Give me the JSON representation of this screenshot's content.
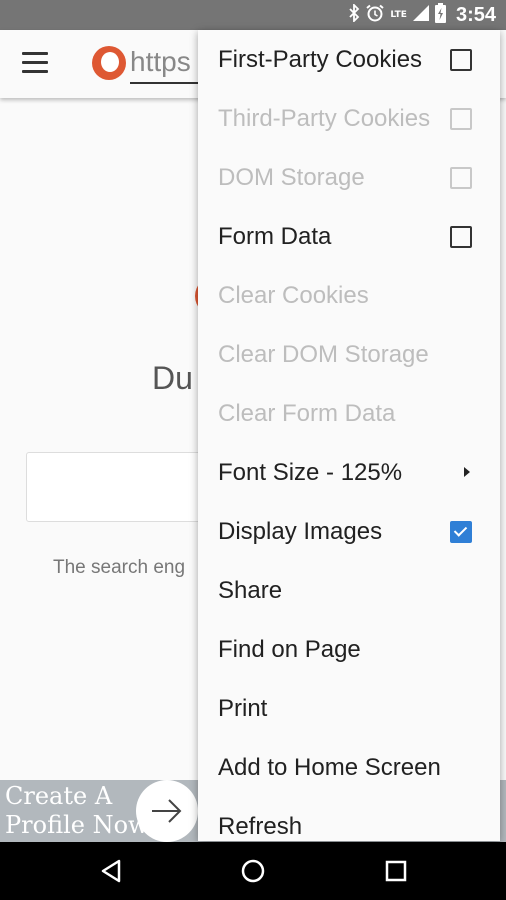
{
  "status_bar": {
    "time": "3:54",
    "network_label": "LTE",
    "icons": [
      "bluetooth-icon",
      "alarm-icon",
      "signal-icon",
      "battery-icon"
    ]
  },
  "toolbar": {
    "url_text": "https"
  },
  "page": {
    "title_fragment": "Du",
    "tagline_fragment": "The search eng"
  },
  "ad": {
    "line1": "Create A",
    "line2": "Profile Now"
  },
  "menu": {
    "items": [
      {
        "label": "First-Party Cookies",
        "enabled": true,
        "control": "checkbox",
        "checked": false
      },
      {
        "label": "Third-Party Cookies",
        "enabled": false,
        "control": "checkbox",
        "checked": false
      },
      {
        "label": "DOM Storage",
        "enabled": false,
        "control": "checkbox",
        "checked": false
      },
      {
        "label": "Form Data",
        "enabled": true,
        "control": "checkbox",
        "checked": false
      },
      {
        "label": "Clear Cookies",
        "enabled": false
      },
      {
        "label": "Clear DOM Storage",
        "enabled": false
      },
      {
        "label": "Clear Form Data",
        "enabled": false
      },
      {
        "label": "Font Size - 125%",
        "enabled": true,
        "control": "submenu"
      },
      {
        "label": "Display Images",
        "enabled": true,
        "control": "checkbox",
        "checked": true
      },
      {
        "label": "Share",
        "enabled": true
      },
      {
        "label": "Find on Page",
        "enabled": true
      },
      {
        "label": "Print",
        "enabled": true
      },
      {
        "label": "Add to Home Screen",
        "enabled": true
      },
      {
        "label": "Refresh",
        "enabled": true
      }
    ]
  },
  "colors": {
    "status_bar": "#757575",
    "accent_checkbox": "#2f7fd6",
    "duckduckgo_orange": "#de5833"
  }
}
